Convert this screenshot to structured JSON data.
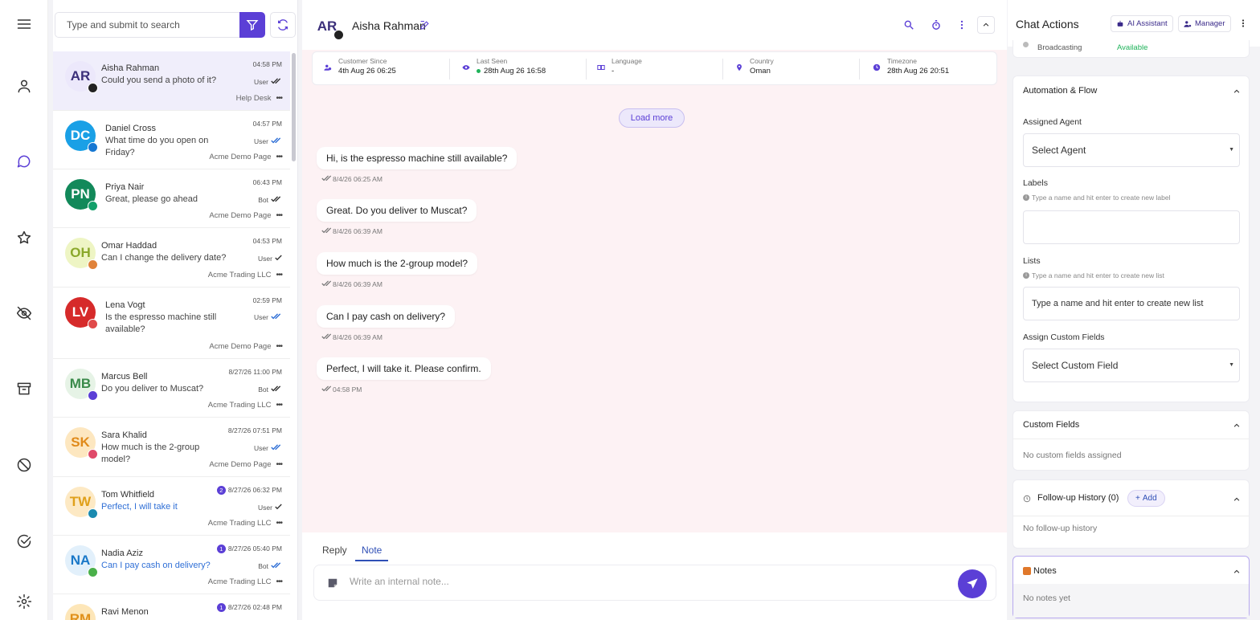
{
  "search": {
    "placeholder": "Type and submit to search"
  },
  "rail": {
    "items": [
      "menu-icon",
      "person-icon",
      "chat-icon",
      "star-icon",
      "eye-off-icon",
      "archive-icon",
      "block-icon",
      "check-circle-icon",
      "gear-icon"
    ],
    "active": "chat-icon"
  },
  "conversations": [
    {
      "initials": "AR",
      "name": "Aisha Rahman",
      "message": "Could you send a photo of it?",
      "time": "04:58 PM",
      "role": "User",
      "ticks": "double",
      "page": "Help Desk",
      "color": "#ece8fb",
      "text_color": "#3b2f7a",
      "badge_color": "#222",
      "selected": true
    },
    {
      "initials": "DC",
      "name": "Daniel Cross",
      "message": "What time do you open on Friday?",
      "time": "04:57 PM",
      "role": "User",
      "ticks": "double-blue",
      "page": "Acme Demo Page",
      "color": "#1aa0e6",
      "text_color": "#ffffff",
      "badge_color": "#1677d2"
    },
    {
      "initials": "PN",
      "name": "Priya Nair",
      "message": "Great, please go ahead",
      "time": "06:43 PM",
      "role": "Bot",
      "ticks": "double",
      "page": "Acme Demo Page",
      "color": "#12895a",
      "text_color": "#ffffff",
      "badge_color": "#12a06a"
    },
    {
      "initials": "OH",
      "name": "Omar Haddad",
      "message": "Can I change the delivery date?",
      "time": "04:53 PM",
      "role": "User",
      "ticks": "single",
      "page": "Acme Trading LLC",
      "color": "#eef5c4",
      "text_color": "#8aa82a",
      "badge_color": "#e0823a"
    },
    {
      "initials": "LV",
      "name": "Lena Vogt",
      "message": "Is the espresso machine still available?",
      "time": "02:59 PM",
      "role": "User",
      "ticks": "double-blue",
      "page": "Acme Demo Page",
      "color": "#d62a2a",
      "text_color": "#ffffff",
      "badge_color": "#e04a4a"
    },
    {
      "initials": "MB",
      "name": "Marcus Bell",
      "message": "Do you deliver to Muscat?",
      "time": "8/27/26 11:00 PM",
      "role": "Bot",
      "ticks": "double",
      "page": "Acme Trading LLC",
      "color": "#e6f3e6",
      "text_color": "#3a8a4a",
      "badge_color": "#5b3fd6"
    },
    {
      "initials": "SK",
      "name": "Sara Khalid",
      "message": "How much is the 2-group model?",
      "time": "8/27/26 07:51 PM",
      "role": "User",
      "ticks": "double-blue",
      "page": "Acme Demo Page",
      "color": "#fde7c0",
      "text_color": "#e08a1a",
      "badge_color": "#e04a6a"
    },
    {
      "initials": "TW",
      "name": "Tom Whitfield",
      "message": "Perfect, I will take it",
      "time": "8/27/26 06:32 PM",
      "role": "User",
      "ticks": "single",
      "page": "Acme Trading LLC",
      "color": "#fde9c4",
      "text_color": "#e0a01a",
      "badge_color": "#1a8ab0",
      "unread": "2",
      "blue": true
    },
    {
      "initials": "NA",
      "name": "Nadia Aziz",
      "message": "Can I pay cash on delivery?",
      "time": "8/27/26 05:40 PM",
      "role": "Bot",
      "ticks": "double-blue",
      "page": "Acme Trading LLC",
      "color": "#e2f0fb",
      "text_color": "#1a78c8",
      "badge_color": "#4ab04a",
      "unread": "1",
      "blue": true
    },
    {
      "initials": "RM",
      "name": "Ravi Menon",
      "message": "",
      "time": "8/27/26 02:48 PM",
      "role": "",
      "ticks": "",
      "page": "",
      "color": "#fde6b8",
      "text_color": "#e0901a",
      "badge_color": "#e0901a",
      "unread": "1"
    }
  ],
  "chat": {
    "initials": "AR",
    "name": "Aisha Rahman",
    "info": [
      {
        "label": "Customer Since",
        "value": "4th Aug 26 06:25",
        "icon": "user-clock-icon"
      },
      {
        "label": "Last Seen",
        "value": "28th Aug 26 16:58",
        "icon": "eye-icon"
      },
      {
        "label": "Language",
        "value": "-",
        "icon": "language-icon"
      },
      {
        "label": "Country",
        "value": "Oman",
        "icon": "location-icon"
      },
      {
        "label": "Timezone",
        "value": "28th Aug 26 20:51",
        "icon": "clock-icon"
      }
    ],
    "load_more": "Load more",
    "messages": [
      {
        "text": "Hi, is the espresso machine still available?",
        "time": "8/4/26 06:25 AM"
      },
      {
        "text": "Great. Do you deliver to Muscat?",
        "time": "8/4/26 06:39 AM"
      },
      {
        "text": "How much is the 2-group model?",
        "time": "8/4/26 06:39 AM"
      },
      {
        "text": "Can I pay cash on delivery?",
        "time": "8/4/26 06:39 AM"
      },
      {
        "text": "Perfect, I will take it. Please confirm.",
        "time": "04:58 PM"
      }
    ],
    "tabs": {
      "reply": "Reply",
      "note": "Note"
    },
    "note_placeholder": "Write an internal note..."
  },
  "actions": {
    "title": "Chat Actions",
    "ai_assistant": "AI Assistant",
    "manager": "Manager",
    "broadcasting_label": "Broadcasting",
    "broadcasting_value": "Available",
    "automation": {
      "title": "Automation & Flow",
      "assigned_agent": "Assigned Agent",
      "select_agent": "Select Agent",
      "labels": "Labels",
      "labels_hint": "Type a name and hit enter to create new label",
      "lists": "Lists",
      "lists_hint": "Type a name and hit enter to create new list",
      "lists_placeholder": "Type a name and hit enter to create new list",
      "custom_fields_label": "Assign Custom Fields",
      "select_custom_field": "Select Custom Field"
    },
    "custom_fields": {
      "title": "Custom Fields",
      "empty": "No custom fields assigned"
    },
    "followup": {
      "title": "Follow-up History (0)",
      "add": "Add",
      "empty": "No follow-up history"
    },
    "notes": {
      "title": "Notes",
      "empty": "No notes yet"
    }
  },
  "colors": {
    "accent": "#5b3fd6",
    "chat_bg": "#fdf2f4",
    "online": "#1fb35a",
    "available": "#1fb35a"
  }
}
